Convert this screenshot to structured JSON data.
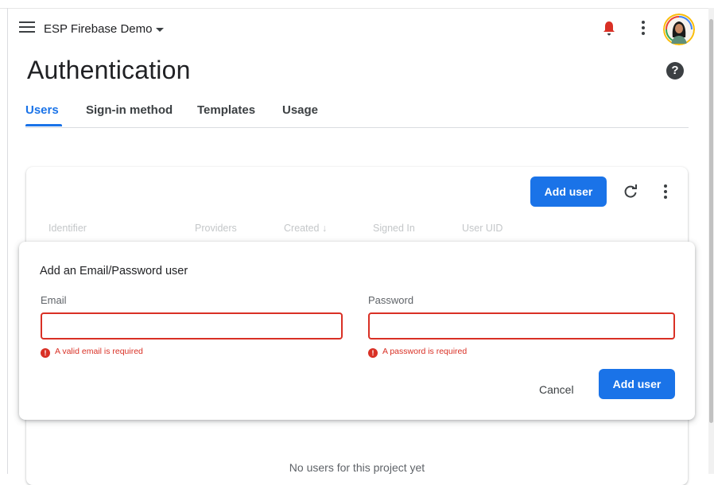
{
  "header": {
    "project_name": "ESP Firebase Demo",
    "icons": {
      "menu": "menu-icon",
      "caret": "arrow-drop-down-icon",
      "notifications": "bell-icon",
      "more": "more-vert-icon",
      "avatar": "avatar"
    }
  },
  "page": {
    "title": "Authentication",
    "help_icon_glyph": "?"
  },
  "tabs": [
    {
      "label": "Users",
      "active": true
    },
    {
      "label": "Sign-in method",
      "active": false
    },
    {
      "label": "Templates",
      "active": false
    },
    {
      "label": "Usage",
      "active": false
    }
  ],
  "users_card": {
    "add_user_label": "Add user",
    "columns": [
      "Identifier",
      "Providers",
      "Created ↓",
      "Signed In",
      "User UID"
    ],
    "empty_message": "No users for this project yet"
  },
  "dialog": {
    "title": "Add an Email/Password user",
    "email": {
      "label": "Email",
      "value": "",
      "error": "A valid email is required"
    },
    "password": {
      "label": "Password",
      "value": "",
      "error": "A password is required"
    },
    "error_icon_glyph": "!",
    "cancel_label": "Cancel",
    "submit_label": "Add user"
  },
  "colors": {
    "primary": "#1a73e8",
    "error": "#d93025",
    "text": "#202124"
  }
}
